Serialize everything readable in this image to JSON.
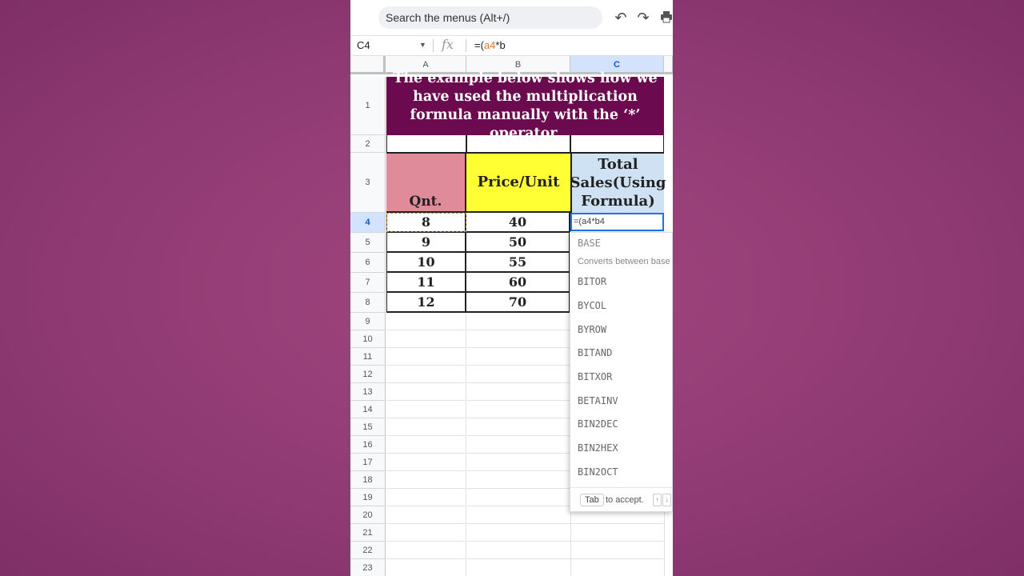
{
  "toolbar": {
    "search_placeholder": "Search the menus (Alt+/)",
    "undo_icon": "undo-icon",
    "redo_icon": "redo-icon",
    "print_icon": "print-icon"
  },
  "formula_bar": {
    "name_box": "C4",
    "fx_label": "fx",
    "formula_prefix": "=(",
    "formula_ref": "a4",
    "formula_suffix": "*b"
  },
  "columns": [
    "A",
    "B",
    "C"
  ],
  "rows": [
    "1",
    "2",
    "3",
    "4",
    "5",
    "6",
    "7",
    "8",
    "9",
    "10",
    "11",
    "12",
    "13",
    "14",
    "15",
    "16",
    "17",
    "18",
    "19",
    "20",
    "21",
    "22",
    "23"
  ],
  "sheet": {
    "banner": "The example below shows how we have used the multiplication formula manually with the ‘*’ operator.",
    "header_qnt": "Qnt.",
    "header_price": "Price/Unit",
    "header_total": "Total Sales(Using Formula)",
    "data": [
      {
        "qnt": "8",
        "price": "40"
      },
      {
        "qnt": "9",
        "price": "50"
      },
      {
        "qnt": "10",
        "price": "55"
      },
      {
        "qnt": "11",
        "price": "60"
      },
      {
        "qnt": "12",
        "price": "70"
      }
    ],
    "editing_cell": "=(a4*b4",
    "colors": {
      "banner_bg": "#6b0a4f",
      "qnt_bg": "#df8b9a",
      "price_bg": "#ffff33",
      "total_bg": "#cfe2f3"
    }
  },
  "autocomplete": {
    "items": [
      "BASE",
      "BITOR",
      "BYCOL",
      "BYROW",
      "BITAND",
      "BITXOR",
      "BETAINV",
      "BIN2DEC",
      "BIN2HEX",
      "BIN2OCT"
    ],
    "description": "Converts between base",
    "tab_key": "Tab",
    "accept_text": "to accept."
  }
}
